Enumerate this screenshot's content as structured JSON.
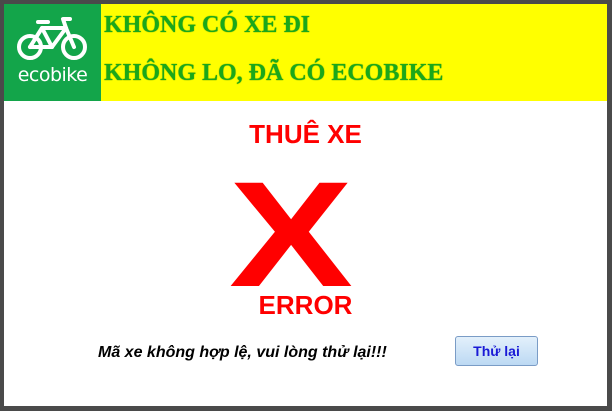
{
  "header": {
    "logo_text": "ecobike",
    "logo_icon": "bicycle-icon",
    "slogan_line1": "KHÔNG CÓ XE ĐI",
    "slogan_line2": "KHÔNG LO, ĐÃ CÓ ECOBIKE"
  },
  "main": {
    "title": "THUÊ XE",
    "error_mark": "X",
    "error_label": "ERROR",
    "message": "Mã xe không hợp lệ, vui lòng thử lại!!!",
    "retry_label": "Thử lại"
  },
  "colors": {
    "header_bg": "#ffff00",
    "logo_bg": "#13a54a",
    "slogan_text": "#1aa81a",
    "error_red": "#ff0000",
    "button_text": "#1a1ad6"
  }
}
